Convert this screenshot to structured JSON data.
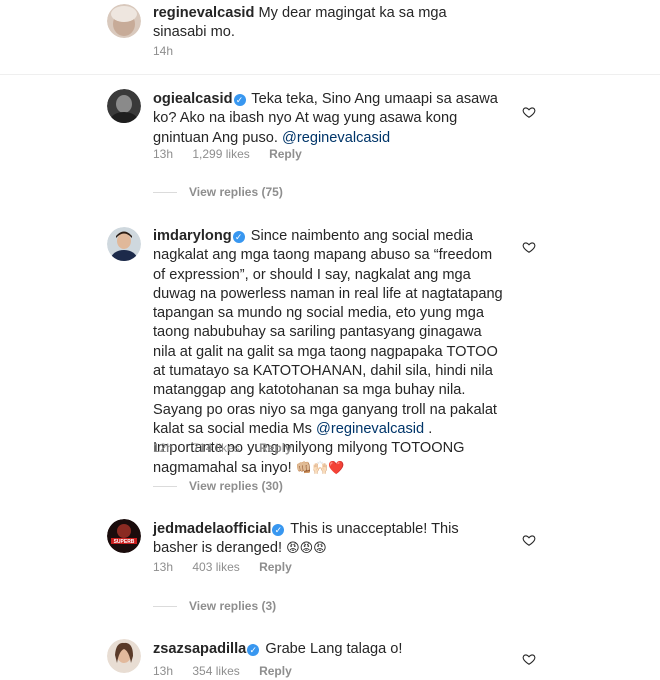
{
  "comments": [
    {
      "username": "reginevalcasid",
      "verified": false,
      "text": "My dear magingat ka sa mga sinasabi mo.",
      "time": "14h"
    },
    {
      "username": "ogiealcasid",
      "verified": true,
      "text": "Teka teka, Sino Ang umaapi sa asawa ko? Ako na ibash nyo At wag yung asawa kong gnintuan Ang puso.",
      "mention": "@reginevalcasid",
      "time": "13h",
      "likes": "1,299 likes",
      "reply": "Reply",
      "view_replies": "View replies (75)"
    },
    {
      "username": "imdarylong",
      "verified": true,
      "text_lines": [
        "Since naimbento ang social media",
        "nagkalat ang mga taong mapang abuso sa “freedom",
        "of expression”, or should I say, nagkalat ang mga",
        "duwag na powerless naman in real life at nagtatapang",
        "tapangan sa mundo ng social media, eto yung mga",
        "taong nabubuhay sa sariling pantasyang ginagawa",
        "nila at galit na galit sa mga taong nagpapaka TOTOO",
        "at tumatayo sa KATOTOHANAN, dahil sila, hindi nila",
        "matanggap ang katotohanan sa mga buhay nila.",
        "Sayang po oras niyo sa mga ganyang troll na pakalat",
        "kalat sa social media Ms"
      ],
      "mention": "@reginevalcasid",
      "after_mention": ".",
      "text_end_1": "Importante po yung milyong milyong TOTOONG",
      "text_end_2": "nagmamahal sa inyo!",
      "emojis": "👊🏼🙌🏻❤️",
      "time": "12h",
      "likes": "714 likes",
      "reply": "Reply",
      "view_replies": "View replies (30)"
    },
    {
      "username": "jedmadelaofficial",
      "verified": true,
      "text": "This is unacceptable! This basher is deranged!",
      "emojis": "😡😡😡",
      "avatar_text": "SUPERB",
      "time": "13h",
      "likes": "403 likes",
      "reply": "Reply",
      "view_replies": "View replies (3)"
    },
    {
      "username": "zsazsapadilla",
      "verified": true,
      "text": "Grabe Lang talaga o!",
      "time": "13h",
      "likes": "354 likes",
      "reply": "Reply"
    }
  ],
  "colors": {
    "text": "#262626",
    "meta": "#8e8e8e",
    "verified": "#3897f0",
    "mention": "#003569"
  },
  "icons": {
    "like": "heart-outline-icon",
    "verified": "verified-badge-icon"
  }
}
